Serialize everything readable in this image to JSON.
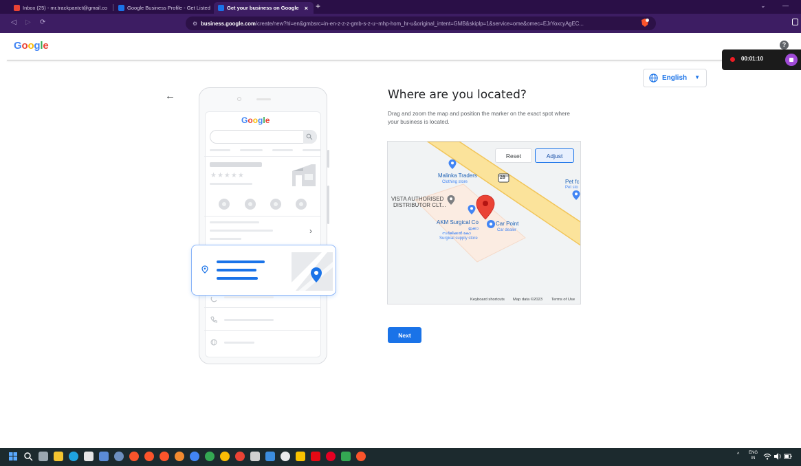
{
  "browser": {
    "tabs": [
      {
        "label": "Inbox (25) - mr.trackpantct@gmail.co",
        "favicon_color": "#ea4335"
      },
      {
        "label": "Google Business Profile - Get Listed o",
        "favicon_color": "#1a73e8"
      },
      {
        "label": "Get your business on Google",
        "favicon_color": "#1a73e8",
        "active": true
      }
    ],
    "tab_close": "×",
    "new_tab": "+",
    "minimize": "—",
    "dropdown": "⌄",
    "nav": {
      "back": "◁",
      "forward": "▷",
      "reload": "⟳"
    },
    "address": {
      "domain": "business.google.com",
      "path": "/create/new?hl=en&gmbsrc=in-en-z-z-z-gmb-s-z-u~mhp-hom_hr-u&original_intent=GMB&skiplp=1&service=ome&omec=EJrYoxcyAgEC..."
    }
  },
  "header": {
    "logo": [
      "G",
      "o",
      "o",
      "g",
      "l",
      "e"
    ],
    "logo_colors": [
      "#4285f4",
      "#ea4335",
      "#fbbc05",
      "#4285f4",
      "#34a853",
      "#ea4335"
    ],
    "help": "?"
  },
  "recorder": {
    "time": "00:01:10"
  },
  "language": {
    "selected": "English",
    "caret": "▼"
  },
  "back": "←",
  "illustration": {
    "logo": [
      "G",
      "o",
      "o",
      "g",
      "l",
      "e"
    ],
    "stars": "★★★★★",
    "chevron": "›"
  },
  "main": {
    "title": "Where are you located?",
    "description": "Drag and zoom the map and position the marker on the exact spot where your business is located.",
    "next_button": "Next"
  },
  "map": {
    "reset_button": "Reset",
    "adjust_button": "Adjust",
    "places": [
      {
        "name": "Malinka Traders",
        "category": "Clothing store"
      },
      {
        "name": "VISTA AUTHORISED",
        "name2": "DISTRIBUTOR CLT..."
      },
      {
        "name": "AKM Surgical Co",
        "local": "ഇക്കാ",
        "local2": "സർജിക്കൽ കോ",
        "category": "Surgical supply store"
      },
      {
        "name": "Car Point",
        "category": "Car dealer"
      },
      {
        "name": "Pet fc",
        "category": "Pet sto"
      }
    ],
    "road_shield": "28",
    "footer": {
      "shortcuts": "Keyboard shortcuts",
      "data": "Map data ©2023",
      "terms": "Terms of Use"
    },
    "colors": {
      "road": "#fbe39b",
      "road_edge": "#f1c55a",
      "parcel": "#fbece2",
      "pin": "#ea4335",
      "poi": "#4285f4"
    }
  },
  "taskbar": {
    "tray": {
      "chevron": "^",
      "lang": "ENG",
      "region": "IN"
    }
  }
}
